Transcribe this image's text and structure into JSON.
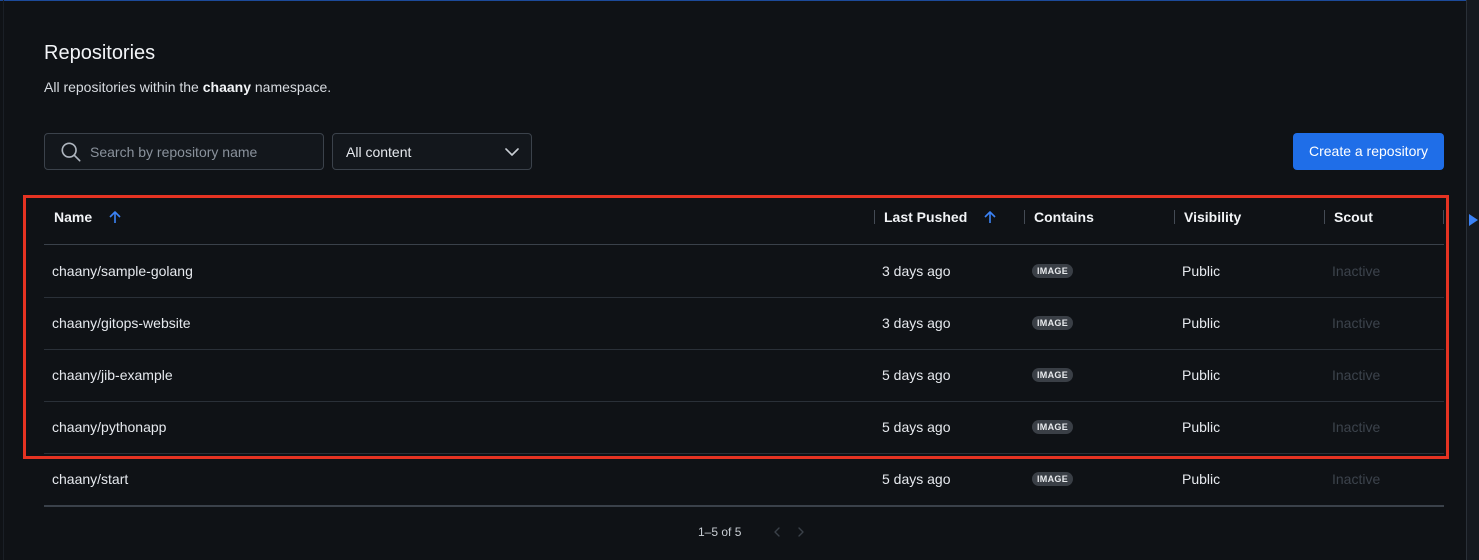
{
  "page": {
    "title": "Repositories",
    "subtitle_prefix": "All repositories within the ",
    "namespace": "chaany",
    "subtitle_suffix": " namespace."
  },
  "toolbar": {
    "search_placeholder": "Search by repository name",
    "search_value": "",
    "filter_selected": "All content",
    "create_label": "Create a repository"
  },
  "table": {
    "columns": [
      {
        "key": "name",
        "label": "Name",
        "sort": "ascending"
      },
      {
        "key": "last_pushed",
        "label": "Last Pushed",
        "sort": "ascending"
      },
      {
        "key": "contains",
        "label": "Contains"
      },
      {
        "key": "visibility",
        "label": "Visibility"
      },
      {
        "key": "scout",
        "label": "Scout"
      }
    ],
    "rows": [
      {
        "name": "chaany/sample-golang",
        "last_pushed": "3 days ago",
        "contains": "IMAGE",
        "visibility": "Public",
        "scout": "Inactive"
      },
      {
        "name": "chaany/gitops-website",
        "last_pushed": "3 days ago",
        "contains": "IMAGE",
        "visibility": "Public",
        "scout": "Inactive"
      },
      {
        "name": "chaany/jib-example",
        "last_pushed": "5 days ago",
        "contains": "IMAGE",
        "visibility": "Public",
        "scout": "Inactive"
      },
      {
        "name": "chaany/pythonapp",
        "last_pushed": "5 days ago",
        "contains": "IMAGE",
        "visibility": "Public",
        "scout": "Inactive"
      },
      {
        "name": "chaany/start",
        "last_pushed": "5 days ago",
        "contains": "IMAGE",
        "visibility": "Public",
        "scout": "Inactive"
      }
    ]
  },
  "pagination": {
    "range_label": "1–5 of 5"
  },
  "colors": {
    "background": "#0f1216",
    "accent": "#1f6ee8",
    "sort_arrow": "#3b82f6",
    "highlight_border": "#e53322",
    "badge_bg": "#3a3f46",
    "inactive_text": "#3c434c"
  },
  "icons": {
    "search": "search-icon",
    "dropdown": "chevron-down-icon",
    "sort": "arrow-up-icon",
    "prev": "chevron-left-icon",
    "next": "chevron-right-icon"
  }
}
